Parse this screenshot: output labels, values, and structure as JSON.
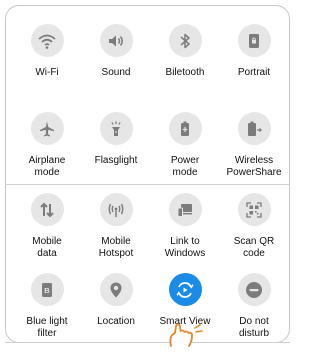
{
  "colors": {
    "tile_bg": "#e6e6e6",
    "icon": "#7c7c7c",
    "active_bg": "#1a8be6",
    "active_icon": "#ffffff",
    "hand": "#e08a2a"
  },
  "tiles": [
    {
      "label": "Wi-Fi",
      "icon": "wifi-icon",
      "active": false
    },
    {
      "label": "Sound",
      "icon": "speaker-icon",
      "active": false
    },
    {
      "label": "Biletooth",
      "icon": "bluetooth-icon",
      "active": false
    },
    {
      "label": "Portrait",
      "icon": "lock-rotation-icon",
      "active": false
    },
    {
      "label": "Airplane\nmode",
      "icon": "airplane-icon",
      "active": false
    },
    {
      "label": "Flasglight",
      "icon": "flashlight-icon",
      "active": false
    },
    {
      "label": "Power\nmode",
      "icon": "battery-saver-icon",
      "active": false
    },
    {
      "label": "Wireless\nPowerShare",
      "icon": "wireless-powershare-icon",
      "active": false
    },
    {
      "label": "Mobile\ndata",
      "icon": "mobile-data-icon",
      "active": false
    },
    {
      "label": "Mobile\nHotspot",
      "icon": "hotspot-icon",
      "active": false
    },
    {
      "label": "Link to\nWindows",
      "icon": "link-to-windows-icon",
      "active": false
    },
    {
      "label": "Scan QR\ncode",
      "icon": "qr-code-icon",
      "active": false
    },
    {
      "label": "Blue light\nfilter",
      "icon": "blue-light-icon",
      "active": false
    },
    {
      "label": "Location",
      "icon": "location-pin-icon",
      "active": false
    },
    {
      "label": "Smart View",
      "icon": "smart-view-icon",
      "active": true
    },
    {
      "label": "Do not\ndisturb",
      "icon": "do-not-disturb-icon",
      "active": false
    }
  ],
  "pointer": {
    "icon": "tap-hand-icon"
  }
}
